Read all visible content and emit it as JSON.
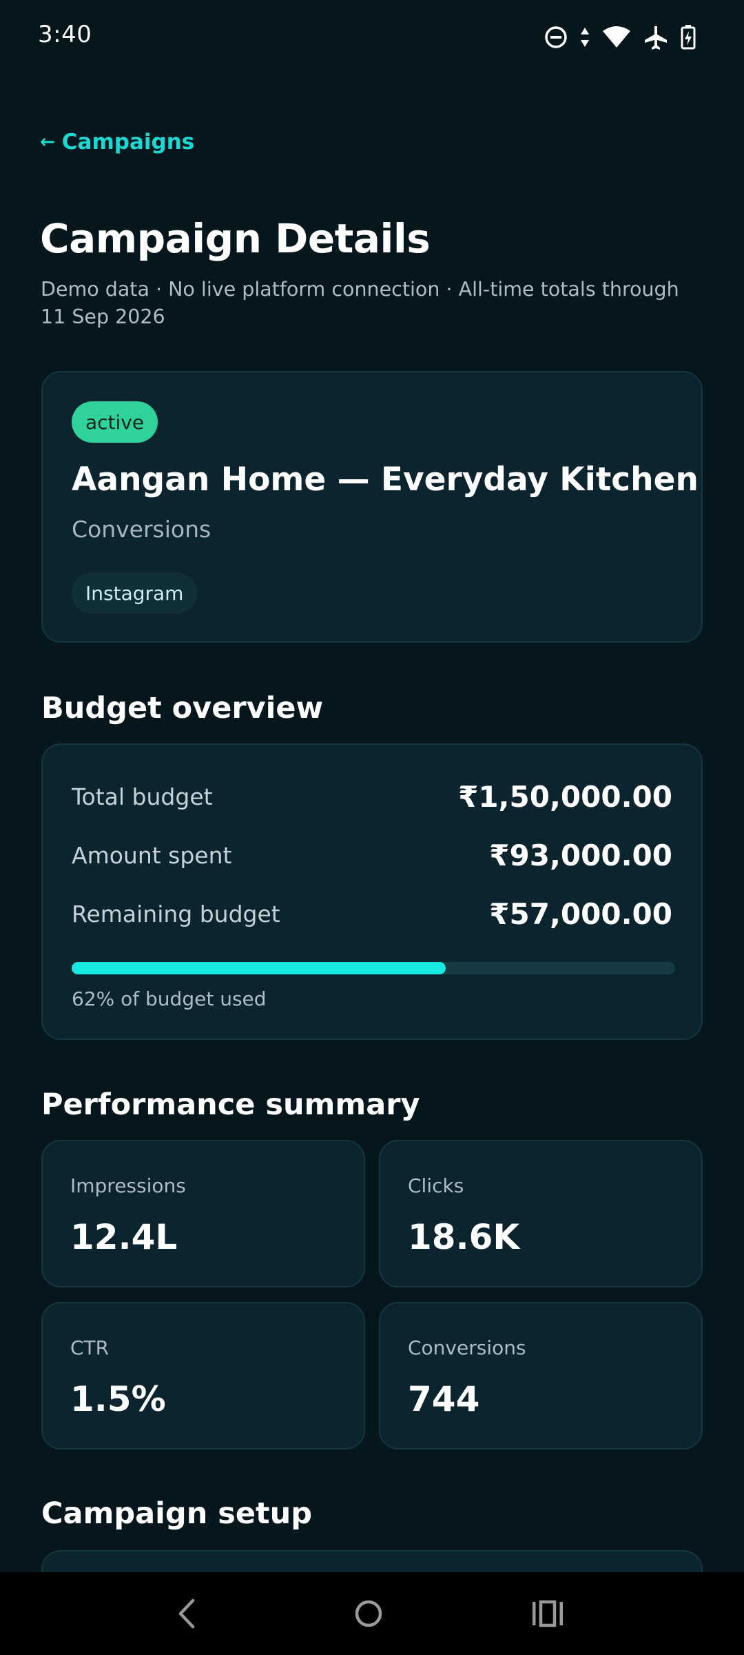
{
  "status_bar": {
    "time": "3:40",
    "icons": [
      "do-not-disturb-icon",
      "data-arrows-icon",
      "wifi-icon",
      "airplane-mode-icon",
      "battery-charging-icon"
    ]
  },
  "header": {
    "back_label": "Campaigns",
    "back_arrow": "←",
    "title": "Campaign Details",
    "subtitle": "Demo data · No live platform connection · All-time totals through 11 Sep 2026"
  },
  "campaign": {
    "status": "active",
    "name": "Aangan Home — Everyday Kitchen",
    "objective": "Conversions",
    "platform": "Instagram"
  },
  "budget": {
    "heading": "Budget overview",
    "total_label": "Total budget",
    "total_value": "₹1,50,000.00",
    "spent_label": "Amount spent",
    "spent_value": "₹93,000.00",
    "remaining_label": "Remaining budget",
    "remaining_value": "₹57,000.00",
    "used_fraction": 0.62,
    "used_caption": "62% of budget used"
  },
  "performance": {
    "heading": "Performance summary",
    "metrics": [
      {
        "label": "Impressions",
        "value": "12.4L"
      },
      {
        "label": "Clicks",
        "value": "18.6K"
      },
      {
        "label": "CTR",
        "value": "1.5%"
      },
      {
        "label": "Conversions",
        "value": "744"
      }
    ]
  },
  "setup": {
    "heading": "Campaign setup"
  },
  "colors": {
    "background": "#06161d",
    "card": "#0b242d",
    "accent": "#19d9d4",
    "active_badge": "#2fd39a"
  },
  "nav": {
    "icons": [
      "back-icon",
      "home-icon",
      "recents-icon"
    ]
  }
}
